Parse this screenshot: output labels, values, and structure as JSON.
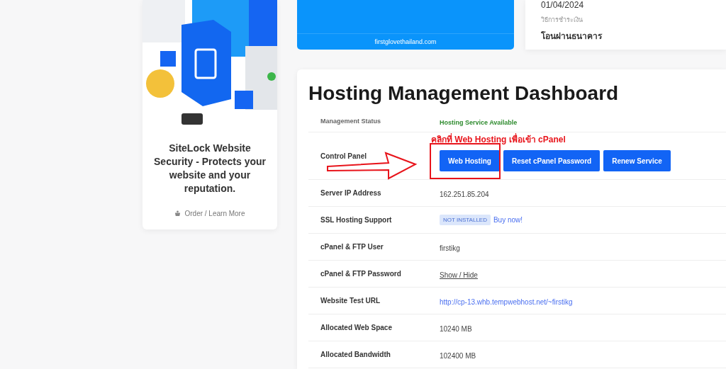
{
  "promo": {
    "title": "SiteLock Website Security - Protects your website and your reputation.",
    "link": "Order / Learn More"
  },
  "domain_card": {
    "domain": "firstglovethailand.com"
  },
  "invoice_card": {
    "date": "01/04/2024",
    "payment_label": "วิธีการชำระเงิน",
    "payment_value": "โอนผ่านธนาคาร"
  },
  "dashboard": {
    "title": "Hosting Management Dashboard",
    "annotation": "คลิกที่ Web Hosting เพื่อเข้า cPanel",
    "rows": [
      {
        "label": "Management Status",
        "kind": "status",
        "value": "Hosting Service Available"
      },
      {
        "label": "Control Panel",
        "kind": "buttons",
        "buttons": [
          {
            "label": "Web Hosting",
            "highlighted": true
          },
          {
            "label": "Reset cPanel Password",
            "highlighted": false
          },
          {
            "label": "Renew Service",
            "highlighted": false
          }
        ]
      },
      {
        "label": "Server IP Address",
        "kind": "text",
        "value": "162.251.85.204"
      },
      {
        "label": "SSL Hosting Support",
        "kind": "badge",
        "badge": "NOT INSTALLED",
        "value": "Buy now!"
      },
      {
        "label": "cPanel & FTP User",
        "kind": "text",
        "value": "firstikg"
      },
      {
        "label": "cPanel & FTP Password",
        "kind": "toggle",
        "value": "Show / Hide"
      },
      {
        "label": "Website Test URL",
        "kind": "link",
        "value": "http://cp-13.whb.tempwebhost.net/~firstikg"
      },
      {
        "label": "Allocated Web Space",
        "kind": "text",
        "value": "10240 MB"
      },
      {
        "label": "Allocated Bandwidth",
        "kind": "text",
        "value": "102400 MB"
      }
    ]
  }
}
